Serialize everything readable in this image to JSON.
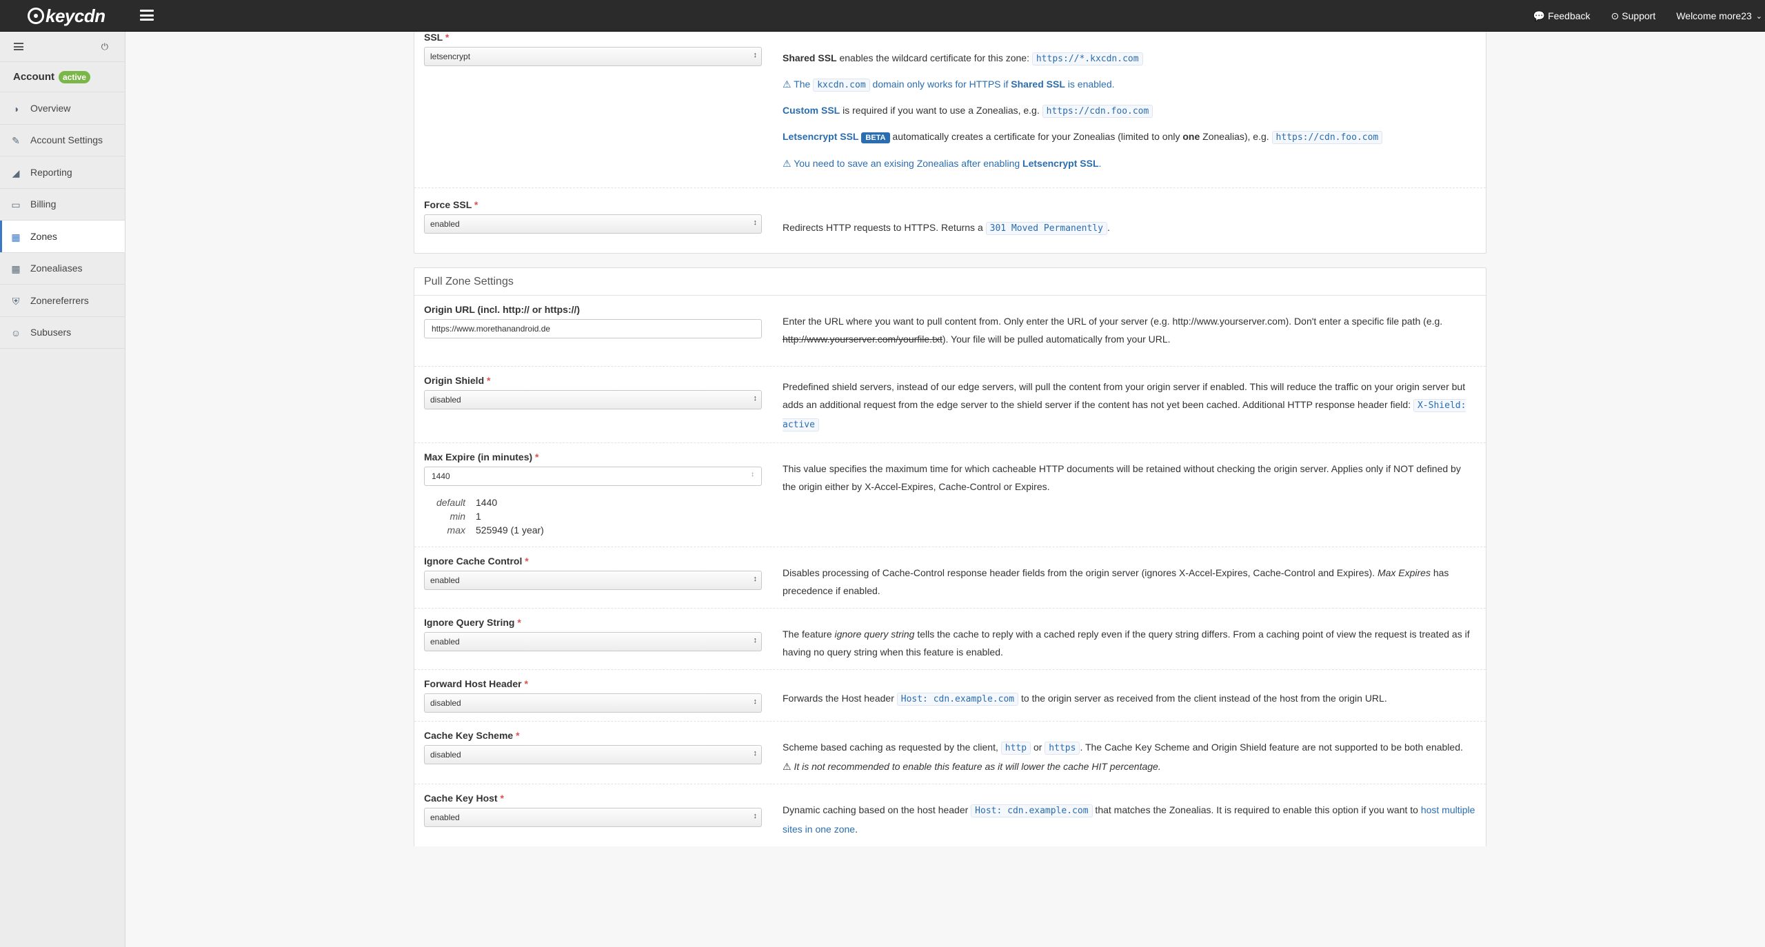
{
  "topbar": {
    "logo_text": "keycdn",
    "feedback": "Feedback",
    "support": "Support",
    "welcome": "Welcome more23"
  },
  "sidebar": {
    "account_label": "Account",
    "account_status": "active",
    "items": [
      {
        "label": "Overview",
        "icon": "dashboard-icon"
      },
      {
        "label": "Account Settings",
        "icon": "edit-icon"
      },
      {
        "label": "Reporting",
        "icon": "chart-icon"
      },
      {
        "label": "Billing",
        "icon": "credit-card-icon"
      },
      {
        "label": "Zones",
        "icon": "grid-icon"
      },
      {
        "label": "Zonealiases",
        "icon": "grid-small-icon"
      },
      {
        "label": "Zonereferrers",
        "icon": "shield-icon"
      },
      {
        "label": "Subusers",
        "icon": "users-icon"
      }
    ],
    "active_item": "Zones"
  },
  "ssl": {
    "label": "SSL",
    "value": "letsencrypt",
    "shared_ssl": "Shared SSL",
    "shared_text": " enables the wildcard certificate for this zone: ",
    "shared_code": "https://*.kxcdn.com",
    "warn1_pre": " The ",
    "warn1_code": "kxcdn.com",
    "warn1_mid": " domain only works for HTTPS if ",
    "warn1_bold": "Shared SSL",
    "warn1_post": " is enabled.",
    "custom_ssl": "Custom SSL",
    "custom_text": " is required if you want to use a Zonealias, e.g. ",
    "custom_code": "https://cdn.foo.com",
    "le_ssl": "Letsencrypt SSL",
    "le_badge": "BETA",
    "le_text1": " automatically creates a certificate for your Zonealias (limited to only ",
    "le_one": "one",
    "le_text2": " Zonealias), e.g. ",
    "le_code": "https://cdn.foo.com",
    "warn2_pre": " You need to save an exising Zonealias after enabling ",
    "warn2_bold": "Letsencrypt SSL",
    "warn2_post": "."
  },
  "force_ssl": {
    "label": "Force SSL",
    "value": "enabled",
    "text": "Redirects HTTP requests to HTTPS. Returns a ",
    "code": "301 Moved Permanently",
    "post": "."
  },
  "pull_zone": {
    "title": "Pull Zone Settings",
    "origin_url": {
      "label": "Origin URL (incl. http:// or https://)",
      "value": "https://www.morethanandroid.de",
      "text1": "Enter the URL where you want to pull content from. Only enter the URL of your server (e.g. http://www.yourserver.com). Don't enter a specific file path (e.g. ",
      "strike": "http://www.yourserver.com/yourfile.txt",
      "text2": "). Your file will be pulled automatically from your URL."
    },
    "origin_shield": {
      "label": "Origin Shield",
      "value": "disabled",
      "text": "Predefined shield servers, instead of our edge servers, will pull the content from your origin server if enabled. This will reduce the traffic on your origin server but adds an additional request from the edge server to the shield server if the content has not yet been cached. Additional HTTP response header field: ",
      "code": "X-Shield: active"
    },
    "max_expire": {
      "label": "Max Expire (in minutes)",
      "value": "1440",
      "text": "This value specifies the maximum time for which cacheable HTTP documents will be retained without checking the origin server. Applies only if NOT defined by the origin either by X-Accel-Expires, Cache-Control or Expires.",
      "limits": [
        {
          "k": "default",
          "v": "1440"
        },
        {
          "k": "min",
          "v": "1"
        },
        {
          "k": "max",
          "v": "525949 (1 year)"
        }
      ]
    },
    "ignore_cache_control": {
      "label": "Ignore Cache Control",
      "value": "enabled",
      "text": "Disables processing of Cache-Control response header fields from the origin server (ignores X-Accel-Expires, Cache-Control and Expires). ",
      "italic": "Max Expires",
      "post": " has precedence if enabled."
    },
    "ignore_query_string": {
      "label": "Ignore Query String",
      "value": "enabled",
      "pre": "The feature ",
      "italic": "ignore query string",
      "text": " tells the cache to reply with a cached reply even if the query string differs. From a caching point of view the request is treated as if having no query string when this feature is enabled."
    },
    "forward_host_header": {
      "label": "Forward Host Header",
      "value": "disabled",
      "pre": "Forwards the Host header ",
      "code": "Host: cdn.example.com",
      "post": " to the origin server as received from the client instead of the host from the origin URL."
    },
    "cache_key_scheme": {
      "label": "Cache Key Scheme",
      "value": "disabled",
      "pre": "Scheme based caching as requested by the client, ",
      "code1": "http",
      "mid": " or ",
      "code2": "https",
      "post": ". The Cache Key Scheme and Origin Shield feature are not supported to be both enabled.",
      "warn": " It is not recommended to enable this feature as it will lower the cache HIT percentage."
    },
    "cache_key_host": {
      "label": "Cache Key Host",
      "value": "enabled",
      "pre": "Dynamic caching based on the host header ",
      "code": "Host: cdn.example.com",
      "mid": " that matches the Zonealias. It is required to enable this option if you want to ",
      "link": "host multiple sites in one zone",
      "post": "."
    }
  },
  "colors": {
    "topbar": "#2b2b2b",
    "sidebar": "#ececec",
    "link": "#2a6db0",
    "active_badge": "#7ab648",
    "required": "#d9534f"
  }
}
